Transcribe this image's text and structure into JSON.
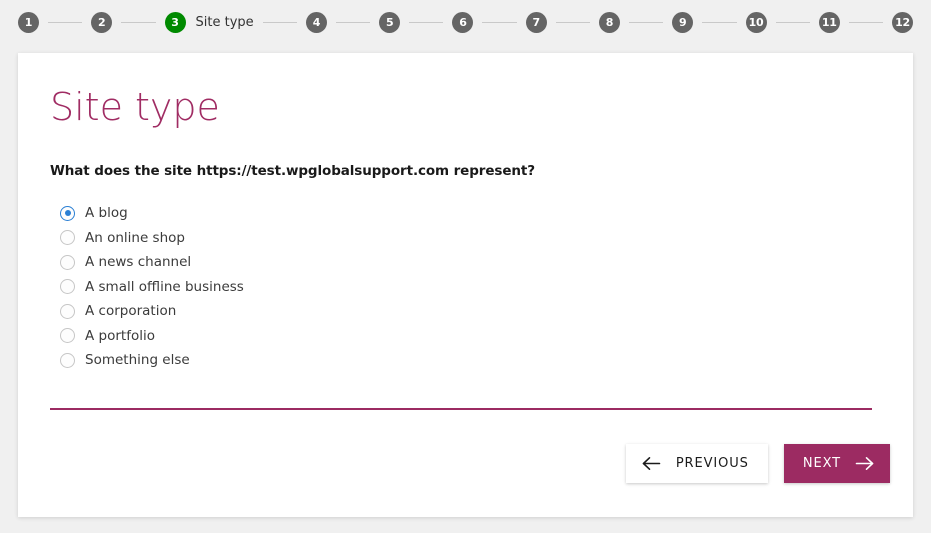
{
  "stepper": {
    "steps": [
      {
        "number": "1",
        "label": "",
        "state": "inactive"
      },
      {
        "number": "2",
        "label": "",
        "state": "inactive"
      },
      {
        "number": "3",
        "label": "Site type",
        "state": "active"
      },
      {
        "number": "4",
        "label": "",
        "state": "inactive"
      },
      {
        "number": "5",
        "label": "",
        "state": "inactive"
      },
      {
        "number": "6",
        "label": "",
        "state": "inactive"
      },
      {
        "number": "7",
        "label": "",
        "state": "inactive"
      },
      {
        "number": "8",
        "label": "",
        "state": "inactive"
      },
      {
        "number": "9",
        "label": "",
        "state": "inactive"
      },
      {
        "number": "10",
        "label": "",
        "state": "inactive"
      },
      {
        "number": "11",
        "label": "",
        "state": "inactive"
      },
      {
        "number": "12",
        "label": "",
        "state": "inactive"
      }
    ],
    "active_color": "#008a00",
    "inactive_color": "#656565"
  },
  "page": {
    "title": "Site type",
    "title_color": "#a02c63",
    "question": "What does the site https://test.wpglobalsupport.com represent?"
  },
  "options": [
    {
      "label": "A blog",
      "selected": true
    },
    {
      "label": "An online shop",
      "selected": false
    },
    {
      "label": "A news channel",
      "selected": false
    },
    {
      "label": "A small offline business",
      "selected": false
    },
    {
      "label": "A corporation",
      "selected": false
    },
    {
      "label": "A portfolio",
      "selected": false
    },
    {
      "label": "Something else",
      "selected": false
    }
  ],
  "selected_accent_color": "#2a7fd4",
  "divider_color": "#9c2b62",
  "buttons": {
    "previous_label": "PREVIOUS",
    "next_label": "NEXT",
    "next_background": "#9c2b62"
  }
}
